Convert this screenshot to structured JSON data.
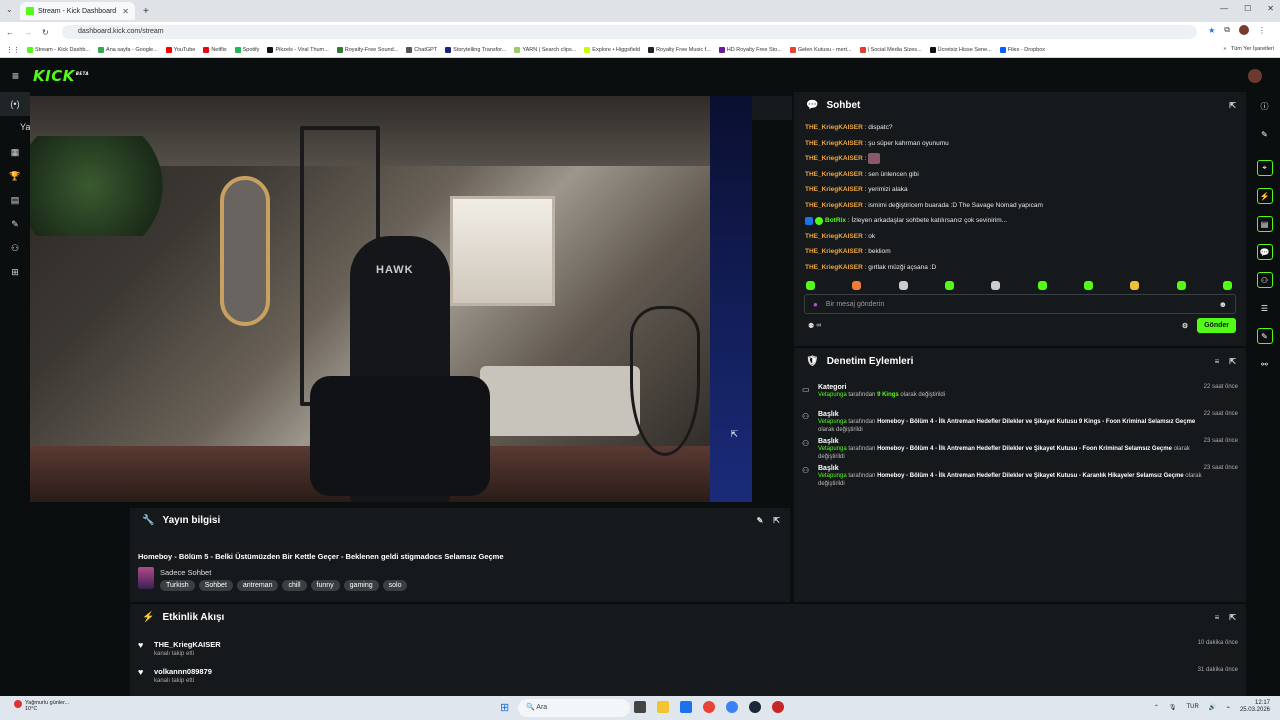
{
  "browser": {
    "tab_title": "Stream - Kick Dashboard",
    "url": "dashboard.kick.com/stream",
    "bookmarks": [
      {
        "label": "Stream - Kick Dashb...",
        "color": "#53fc18"
      },
      {
        "label": "Ana sayfa - Google...",
        "color": "#34a853"
      },
      {
        "label": "YouTube",
        "color": "#ff0000"
      },
      {
        "label": "Netflix",
        "color": "#e50914"
      },
      {
        "label": "Spotify",
        "color": "#1db954"
      },
      {
        "label": "Pikzels - Viral Thum...",
        "color": "#111111"
      },
      {
        "label": "Royalty-Free Sound...",
        "color": "#2e7d32"
      },
      {
        "label": "ChatGPT",
        "color": "#555555"
      },
      {
        "label": "Storytelling Transfor...",
        "color": "#1a237e"
      },
      {
        "label": "YARN | Search clips...",
        "color": "#9ccc65"
      },
      {
        "label": "Explore • Higgsfield",
        "color": "#c6ff00"
      },
      {
        "label": "Royalty Free Music f...",
        "color": "#222222"
      },
      {
        "label": "HD Royalty Free Sto...",
        "color": "#6a1b9a"
      },
      {
        "label": "Gelen Kutusu - mert...",
        "color": "#ea4335"
      },
      {
        "label": "| Social Media Sizes...",
        "color": "#e53935"
      },
      {
        "label": "Ücretsiz Hisse Sene...",
        "color": "#111111"
      },
      {
        "label": "Files - Dropbox",
        "color": "#0061ff"
      }
    ],
    "bookmarks_more": "Tüm Yer İşaretleri"
  },
  "app": {
    "logo": "KICK",
    "logo_sup": "BETA",
    "nav_fragment": "Ya"
  },
  "stream_info": {
    "header": "Yayın bilgisi",
    "title": "Homeboy - Bölüm 5 - Belki Üstümüzden Bir Kettle Geçer - Beklenen geldi stigmadocs Selamsız Geçme",
    "category": "Sadece Sohbet",
    "tags": [
      "Turkish",
      "Sohbet",
      "antreman",
      "chill",
      "funny",
      "gaming",
      "solo"
    ]
  },
  "activity": {
    "header": "Etkinlik Akışı",
    "items": [
      {
        "name": "THE_KriegKAISER",
        "sub": "kanalı takip etti",
        "time": "10 dakika önce"
      },
      {
        "name": "volkannn089879",
        "sub": "kanalı takip etti",
        "time": "31 dakika önce"
      }
    ]
  },
  "chat": {
    "header": "Sohbet",
    "messages": [
      {
        "user": "THE_KriegKAISER",
        "text": ": dispatc?",
        "bot": false
      },
      {
        "user": "THE_KriegKAISER",
        "text": ": şu süper kahrman oyunumu",
        "bot": false
      },
      {
        "user": "THE_KriegKAISER",
        "text": ":",
        "bot": false
      },
      {
        "user": "THE_KriegKAISER",
        "text": ": sen ünlencen gibi",
        "bot": false
      },
      {
        "user": "THE_KriegKAISER",
        "text": ": yerimizi alaka",
        "bot": false
      },
      {
        "user": "THE_KriegKAISER",
        "text": ": ismimi değiştiricem buarada :D The Savage Nomad yapıcam",
        "bot": false
      },
      {
        "user": "BotRix",
        "text": ": İzleyen arkadaşlar sohbete katılırsanız çok sevinirim...",
        "bot": true
      },
      {
        "user": "THE_KriegKAISER",
        "text": ": ok",
        "bot": false
      },
      {
        "user": "THE_KriegKAISER",
        "text": ": bekliom",
        "bot": false
      },
      {
        "user": "THE_KriegKAISER",
        "text": ": gırtlak müzği açsana :D",
        "bot": false
      }
    ],
    "input_placeholder": "Bir mesaj gönderin",
    "send_label": "Gönder",
    "footer_value": "∞"
  },
  "moderation": {
    "header": "Denetim Eylemleri",
    "items": [
      {
        "title": "Kategori",
        "actor": "Vetapunga",
        "mid": " tarafından ",
        "value": "9 Kings",
        "value_green": true,
        "suffix": " olarak değiştirildi",
        "time": "22 saat önce"
      },
      {
        "title": "Başlık",
        "actor": "Vetapunga",
        "mid": " tarafından ",
        "value": "Homeboy - Bölüm 4 - İlk Antreman Hedefler Dilekler ve Şikayet Kutusu 9 Kings - Foon Kriminal Selamsız Geçme",
        "value_green": false,
        "suffix": " olarak değiştirildi",
        "time": "22 saat önce"
      },
      {
        "title": "Başlık",
        "actor": "Vetapunga",
        "mid": " tarafından ",
        "value": "Homeboy - Bölüm 4 - İlk Antreman Hedefler Dilekler ve Şikayet Kutusu - Foon Kriminal Selamsız Geçme",
        "value_green": false,
        "suffix": " olarak değiştirildi",
        "time": "23 saat önce"
      },
      {
        "title": "Başlık",
        "actor": "Vetapunga",
        "mid": " tarafından ",
        "value": "Homeboy - Bölüm 4 - İlk Antreman Hedefler Dilekler ve Şikayet Kutusu - Karanlık Hikayeler Selamsız Geçme",
        "value_green": false,
        "suffix": " olarak değiştirildi",
        "time": "23 saat önce"
      }
    ]
  },
  "video": {
    "chair_text": "HAWK"
  },
  "taskbar": {
    "weather_title": "Yağmurlu günler...",
    "weather_temp": "10°C",
    "search_label": "Ara",
    "lang": "TUR",
    "time": "12:17",
    "date": "25.03.2026"
  },
  "colors": {
    "accent": "#53fc18",
    "username": "#f0a63a",
    "panel": "#16191b",
    "background": "#0b0e0f"
  }
}
